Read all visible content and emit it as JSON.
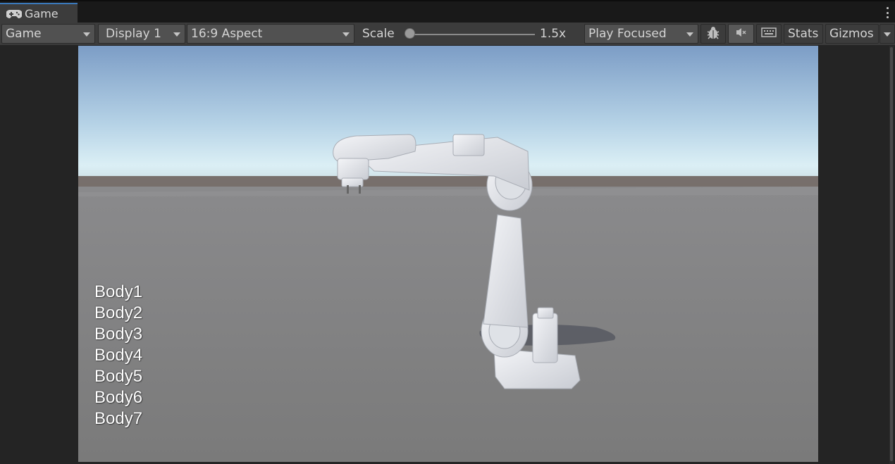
{
  "tab": {
    "label": "Game",
    "icon": "gamepad-icon"
  },
  "toolbar": {
    "mode_dropdown": "Game",
    "display_dropdown": "Display 1",
    "aspect_dropdown": "16:9 Aspect",
    "scale_label": "Scale",
    "scale_value": "1.5x",
    "play_mode_dropdown": "Play Focused",
    "debug_icon": "bug-icon",
    "mute_icon": "mute-audio-icon",
    "keyboard_icon": "keyboard-shortcuts-icon",
    "stats_label": "Stats",
    "gizmos_label": "Gizmos"
  },
  "scene": {
    "description_icon": "robot-arm",
    "body_labels": [
      "Body1",
      "Body2",
      "Body3",
      "Body4",
      "Body5",
      "Body6",
      "Body7"
    ],
    "colors": {
      "sky_top": "#7c9dc6",
      "sky_horizon": "#d9edf3",
      "ground": "#7d7d7d",
      "horizon_band": "#6e635e",
      "robot": "#e6e8ec"
    }
  }
}
